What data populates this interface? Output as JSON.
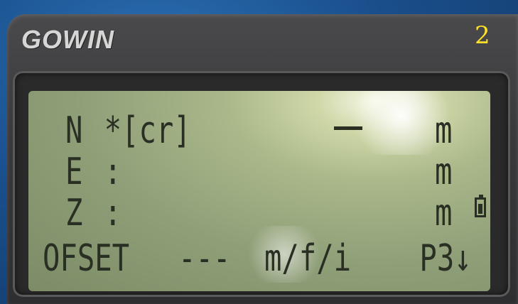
{
  "device": {
    "brand_logo": "GOWIN",
    "page_indicator": "2"
  },
  "screen": {
    "rows": [
      {
        "label": "N",
        "value": "*[cr]",
        "unit": "m"
      },
      {
        "label": "E",
        "value": ":",
        "unit": "m"
      },
      {
        "label": "Z",
        "value": ":",
        "unit": "m"
      }
    ],
    "softkeys": {
      "f1": "OFSET",
      "f2": "---",
      "f3": "m/f/i",
      "f4": "P3↓"
    },
    "status_icons": [
      "battery-icon"
    ]
  }
}
